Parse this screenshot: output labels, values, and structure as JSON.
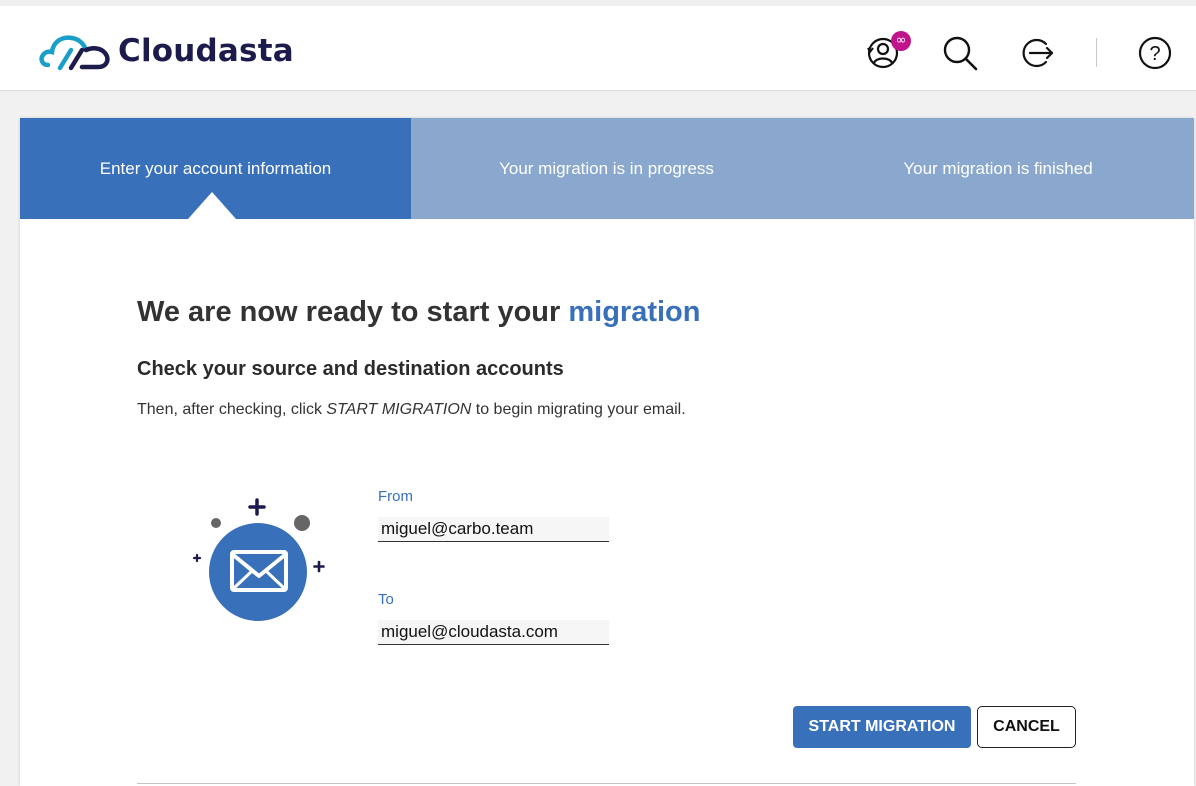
{
  "brand": {
    "name": "Cloudasta"
  },
  "header": {
    "icons": [
      "account-icon",
      "search-icon",
      "logout-icon",
      "help-icon"
    ],
    "badge": "∞"
  },
  "steps": [
    {
      "label": "Enter your account information",
      "active": true
    },
    {
      "label": "Your migration is in progress",
      "active": false
    },
    {
      "label": "Your migration is finished",
      "active": false
    }
  ],
  "main": {
    "title_prefix": "We are now ready to start your ",
    "title_accent": "migration",
    "subtitle": "Check your source and destination accounts",
    "instructions_before": "Then, after checking, click ",
    "instructions_em": "START MIGRATION",
    "instructions_after": " to begin migrating your email."
  },
  "form": {
    "from_label": "From",
    "from_value": "miguel@carbo.team",
    "to_label": "To",
    "to_value": "miguel@cloudasta.com"
  },
  "actions": {
    "start_label": "START MIGRATION",
    "cancel_label": "CANCEL"
  },
  "colors": {
    "primary": "#3870ba",
    "step_inactive": "#8aa8cd",
    "brand_dark": "#1d1b4c",
    "brand_teal": "#1aa0c8",
    "badge": "#c0148c"
  }
}
